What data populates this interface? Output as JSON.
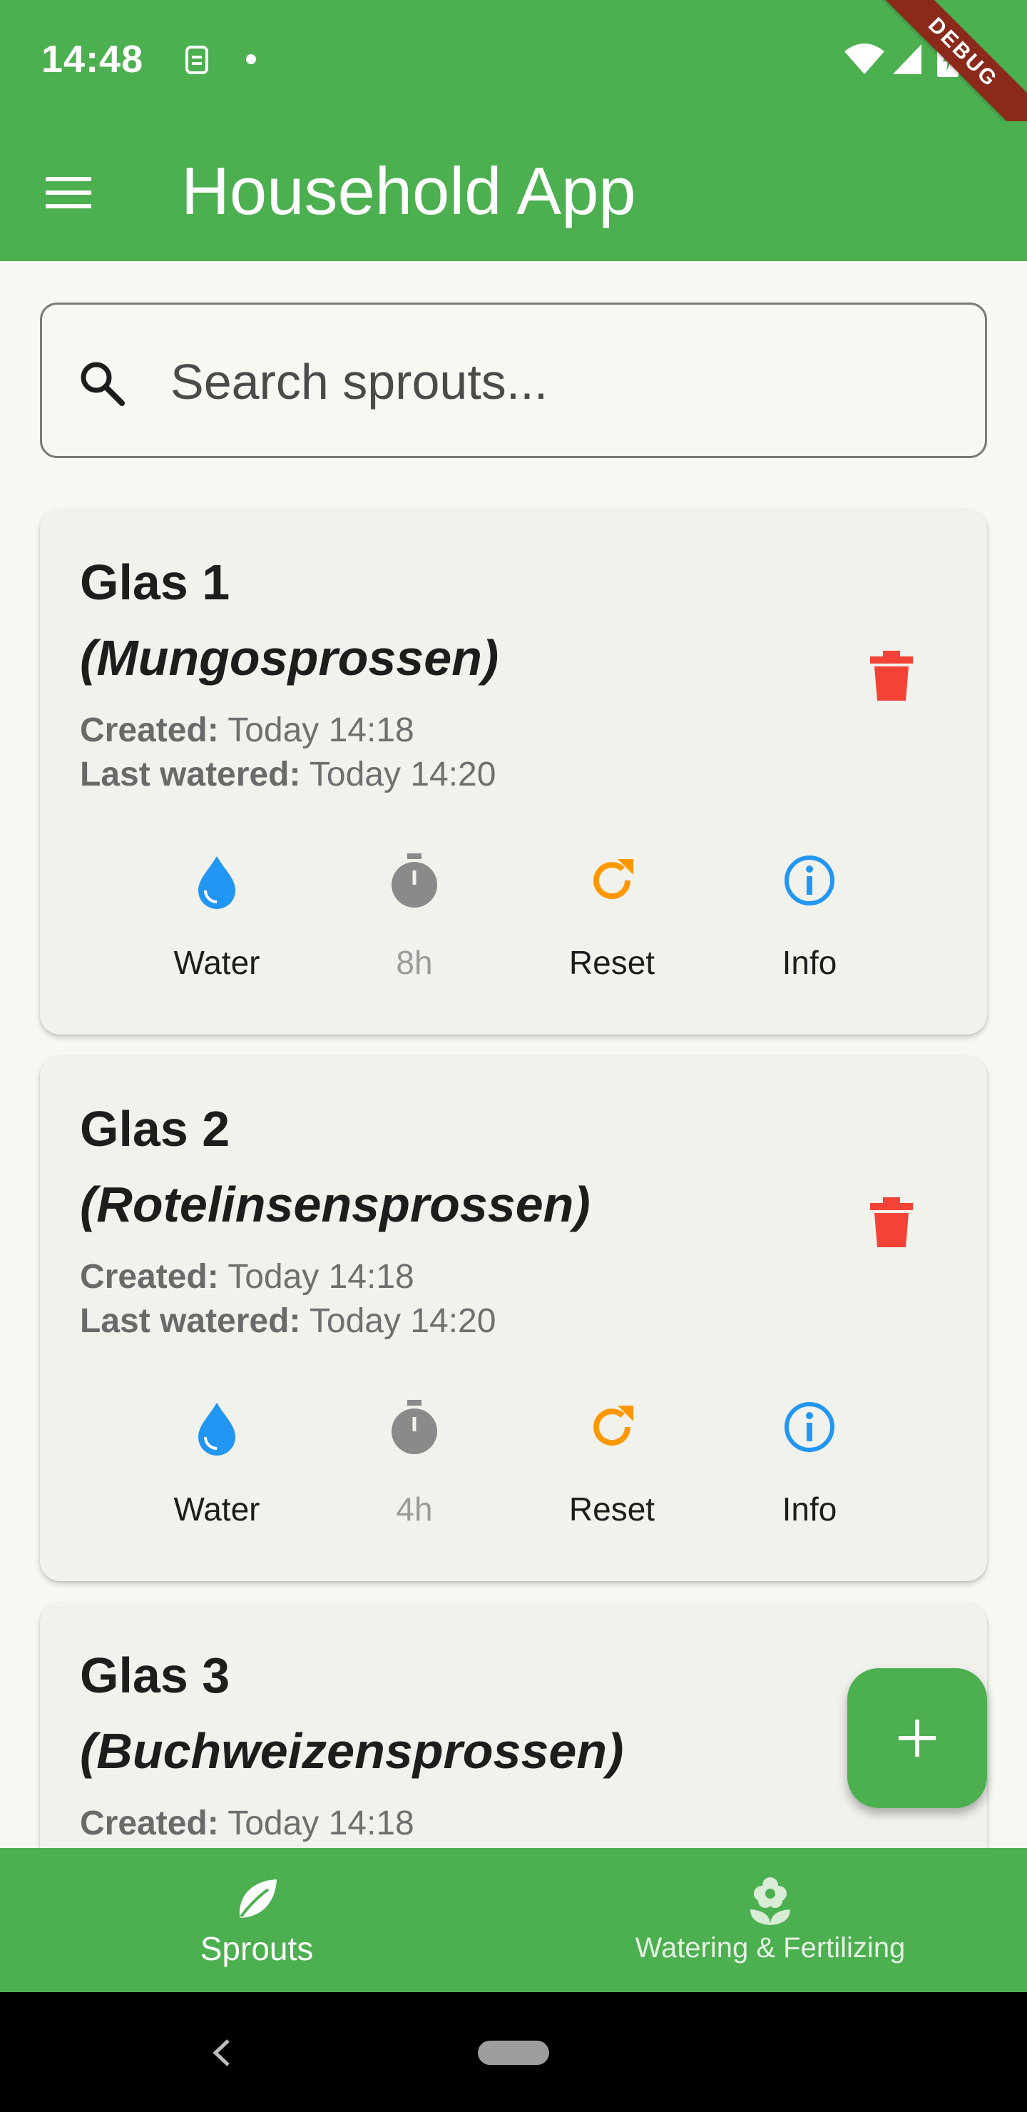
{
  "status_bar": {
    "time": "14:48",
    "debug_label": "DEBUG"
  },
  "app_bar": {
    "title": "Household App",
    "menu_icon": "hamburger-menu-icon"
  },
  "search": {
    "placeholder": "Search sprouts...",
    "value": ""
  },
  "cards": [
    {
      "title": "Glas 1",
      "subtitle": "(Mungosprossen)",
      "created_label": "Created:",
      "created_value": "Today 14:18",
      "watered_label": "Last watered:",
      "watered_value": "Today 14:20",
      "actions": {
        "water": "Water",
        "timer": "8h",
        "reset": "Reset",
        "info": "Info"
      }
    },
    {
      "title": "Glas 2",
      "subtitle": "(Rotelinsensprossen)",
      "created_label": "Created:",
      "created_value": "Today 14:18",
      "watered_label": "Last watered:",
      "watered_value": "Today 14:20",
      "actions": {
        "water": "Water",
        "timer": "4h",
        "reset": "Reset",
        "info": "Info"
      }
    },
    {
      "title": "Glas 3",
      "subtitle": "(Buchweizensprossen)",
      "created_label": "Created:",
      "created_value": "Today 14:18"
    }
  ],
  "bottom_nav": {
    "items": [
      {
        "label": "Sprouts",
        "icon": "leaf-icon",
        "selected": true
      },
      {
        "label": "Watering & Fertilizing",
        "icon": "flower-icon",
        "selected": false
      }
    ]
  },
  "colors": {
    "primary": "#4caf50",
    "water_icon": "#2196f3",
    "timer_icon": "#8a8a8a",
    "reset_icon": "#ff9800",
    "info_icon": "#2196f3",
    "delete_icon": "#f44336",
    "card_bg": "#f2f2ed"
  }
}
